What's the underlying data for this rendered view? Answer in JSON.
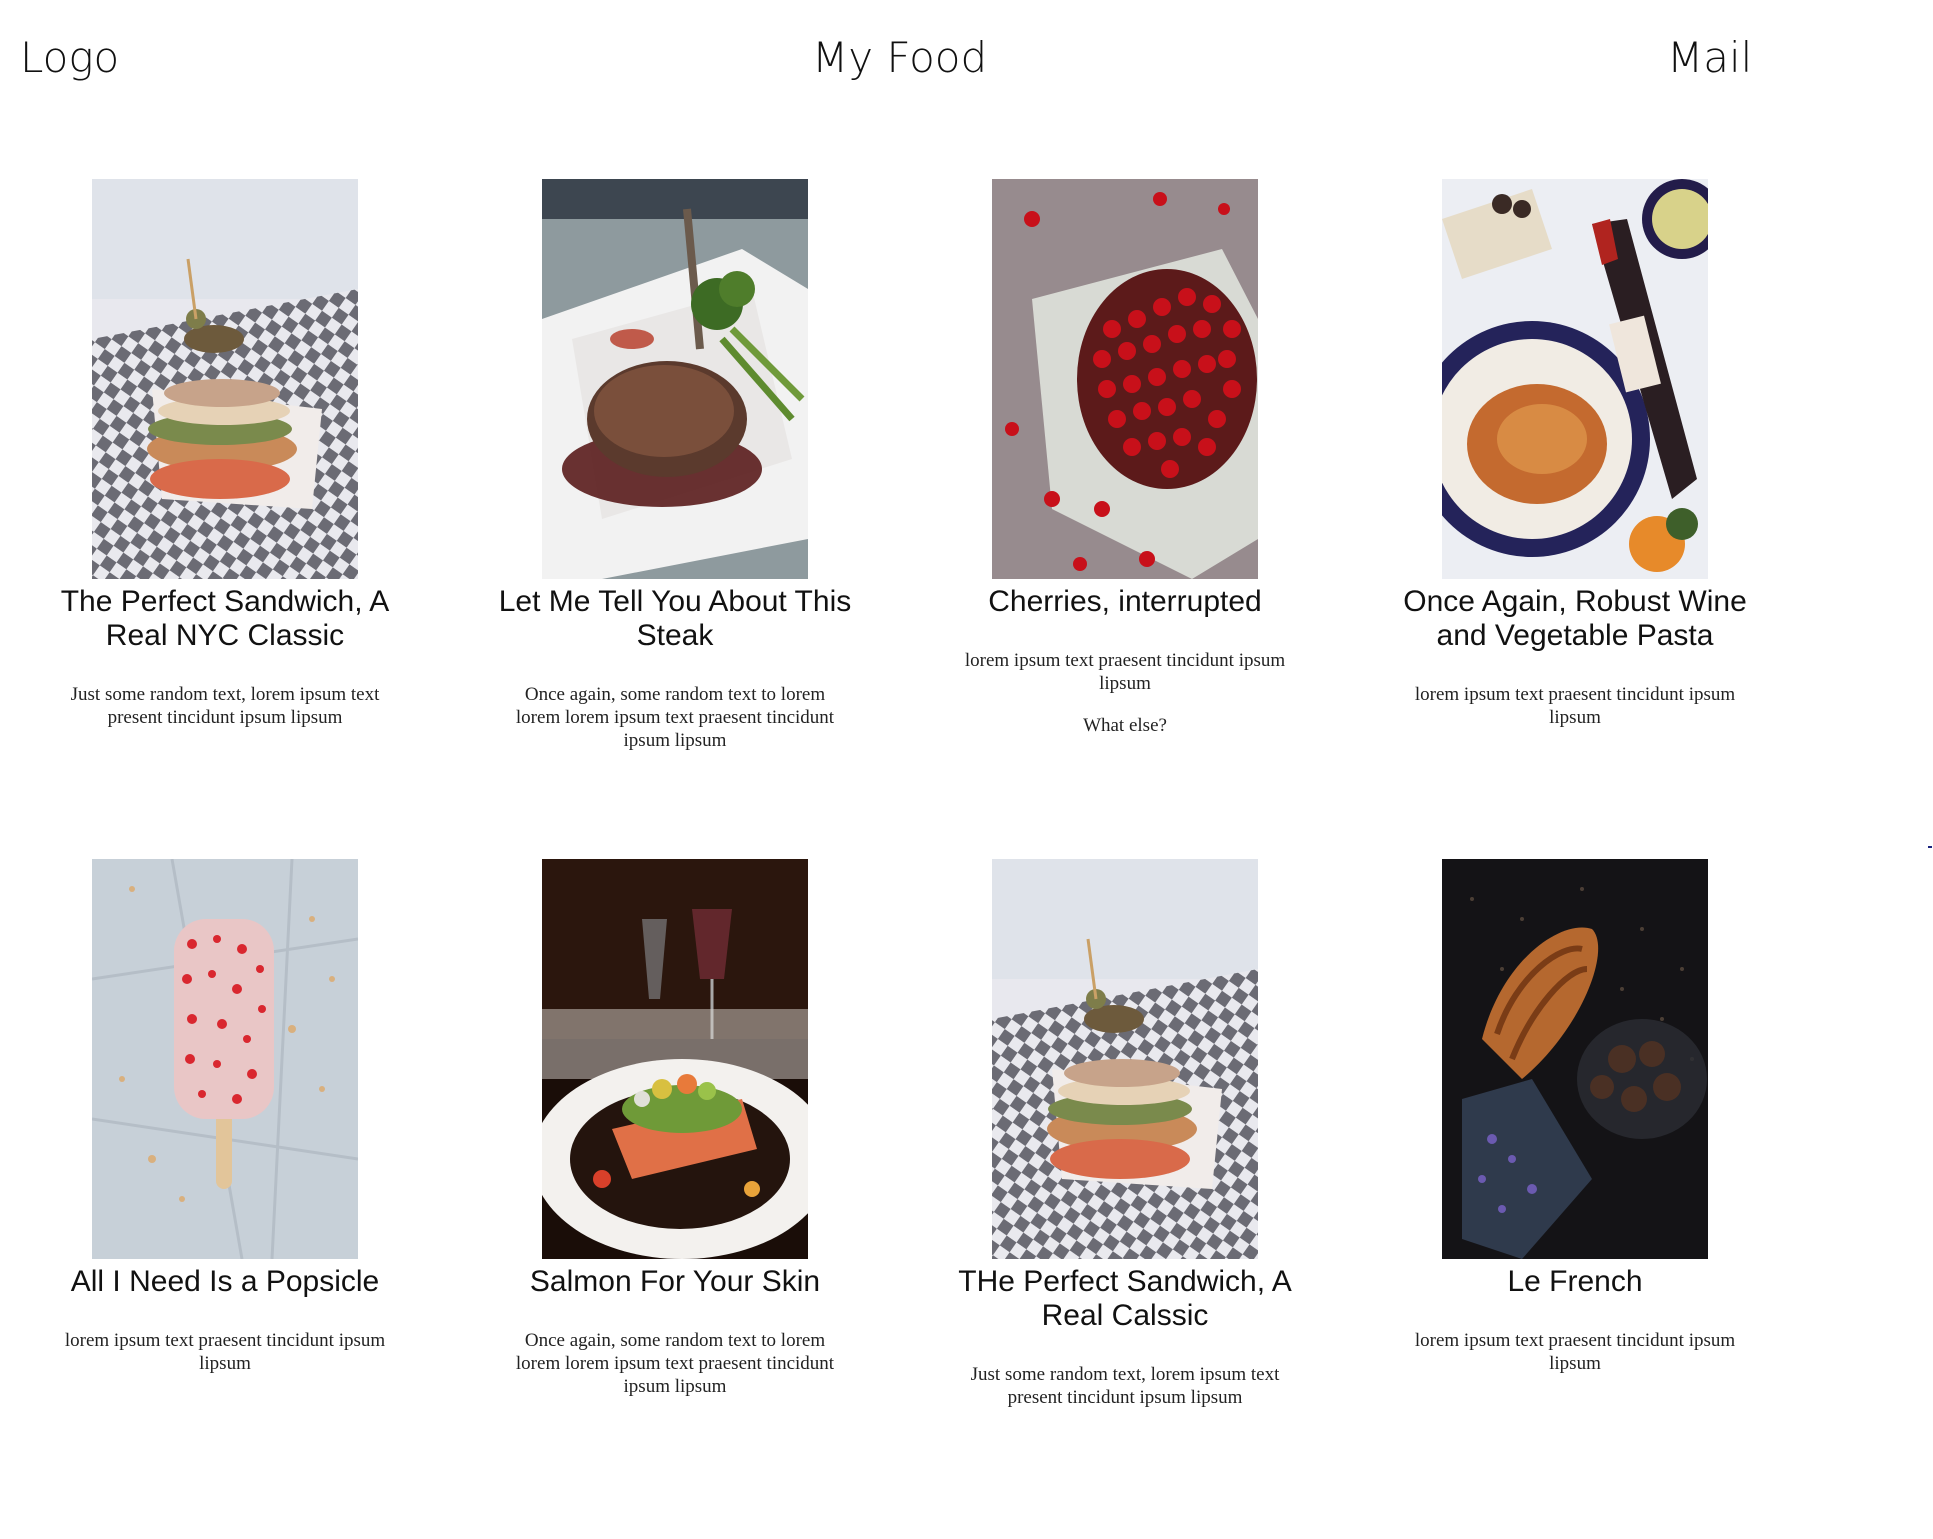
{
  "header": {
    "logo": "Logo",
    "title": "My Food",
    "mail": "Mail"
  },
  "cards": [
    {
      "image_icon": "sandwich-photo",
      "title": "The Perfect Sandwich, A Real NYC Classic",
      "text": [
        "Just some random text, lorem ipsum text present tincidunt ipsum lipsum"
      ]
    },
    {
      "image_icon": "steak-photo",
      "title": "Let Me Tell You About This Steak",
      "text": [
        "Once again, some random text to lorem lorem lorem ipsum text praesent tincidunt ipsum lipsum"
      ]
    },
    {
      "image_icon": "cherries-photo",
      "title": "Cherries, interrupted",
      "text": [
        "lorem ipsum text praesent tincidunt ipsum lipsum",
        "What else?"
      ]
    },
    {
      "image_icon": "wine-pasta-photo",
      "title": "Once Again, Robust Wine and Vegetable Pasta",
      "text": [
        "lorem ipsum text praesent tincidunt ipsum lipsum"
      ]
    },
    {
      "image_icon": "popsicle-photo",
      "title": "All I Need Is a Popsicle",
      "text": [
        "lorem ipsum text praesent tincidunt ipsum lipsum"
      ]
    },
    {
      "image_icon": "salmon-photo",
      "title": "Salmon For Your Skin",
      "text": [
        "Once again, some random text to lorem lorem lorem ipsum text praesent tincidunt ipsum lipsum"
      ]
    },
    {
      "image_icon": "sandwich-photo",
      "title": "THe Perfect Sandwich, A Real Calssic",
      "text": [
        "Just some random text, lorem ipsum text present tincidunt ipsum lipsum"
      ]
    },
    {
      "image_icon": "croissant-photo",
      "title": "Le French",
      "text": [
        "lorem ipsum text praesent tincidunt ipsum lipsum"
      ]
    }
  ]
}
